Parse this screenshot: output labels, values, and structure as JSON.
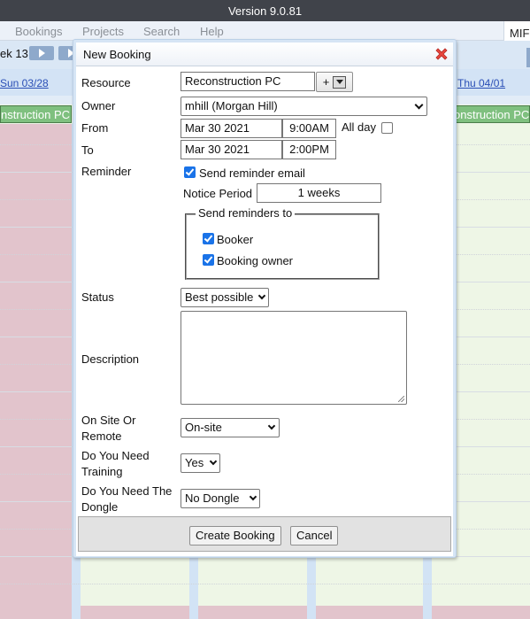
{
  "app": {
    "version": "Version 9.0.81"
  },
  "menu": {
    "items": [
      "Bookings",
      "Projects",
      "Search",
      "Help"
    ],
    "tab_label": "MIF"
  },
  "calendar": {
    "week_label": "ek 13",
    "days": [
      "Sun 03/28",
      "Thu 04/01"
    ],
    "resource_chip": "nstruction PC",
    "resource_chip_right": "onstruction PC",
    "colors": {
      "blocked": "#e2c4cc",
      "available": "#eef6e6",
      "resource_chip": "#7fc07f"
    }
  },
  "dialog": {
    "title": "New Booking",
    "close_icon": "close-x-icon",
    "fields": {
      "resource": {
        "label": "Resource",
        "value": "Reconstruction PC",
        "add_button": "+"
      },
      "owner": {
        "label": "Owner",
        "value": "mhill (Morgan Hill)"
      },
      "from": {
        "label": "From",
        "date": "Mar 30 2021",
        "time": "9:00AM",
        "all_day_label": "All day",
        "all_day_checked": false
      },
      "to": {
        "label": "To",
        "date": "Mar 30 2021",
        "time": "2:00PM"
      },
      "reminder": {
        "label": "Reminder",
        "send_email_label": "Send reminder email",
        "send_email_checked": true,
        "notice_period_label": "Notice Period",
        "notice_period_value": "1 weeks",
        "send_to_legend": "Send reminders to",
        "recipients": [
          {
            "label": "Booker",
            "checked": true
          },
          {
            "label": "Booking owner",
            "checked": true
          }
        ]
      },
      "status": {
        "label": "Status",
        "value": "Best possible"
      },
      "description": {
        "label": "Description",
        "value": ""
      },
      "on_site": {
        "label_line1": "On Site Or",
        "label_line2": "Remote",
        "value": "On-site"
      },
      "training": {
        "label_line1": "Do You Need",
        "label_line2": "Training",
        "value": "Yes"
      },
      "dongle": {
        "label_line1": "Do You Need The",
        "label_line2": "Dongle",
        "value": "No Dongle"
      }
    },
    "buttons": {
      "create": "Create Booking",
      "cancel": "Cancel"
    }
  }
}
